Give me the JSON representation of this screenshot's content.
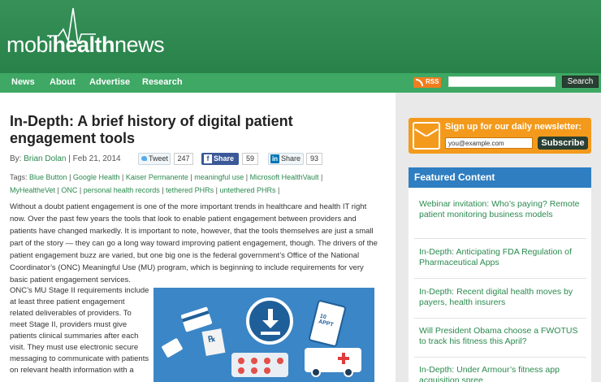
{
  "site": {
    "logo_part1": "mobi",
    "logo_part2": "health",
    "logo_part3": "news"
  },
  "nav": {
    "items": [
      "News",
      "About",
      "Advertise",
      "Research"
    ],
    "rss_label": "RSS",
    "search_placeholder": "",
    "search_button": "Search"
  },
  "article": {
    "title": "In-Depth: A brief history of digital patient engagement tools",
    "by_label": "By:",
    "author": "Brian Dolan",
    "date": "| Feb 21, 2014",
    "tweet_label": "Tweet",
    "tweet_count": "247",
    "fb_label": "Share",
    "fb_count": "59",
    "li_label": "Share",
    "li_count": "93",
    "tags_label": "Tags:",
    "tags": [
      "Blue Button",
      "Google Health",
      "Kaiser Permanente",
      "meaningful use",
      "Microsoft HealthVault",
      "MyHealtheVet",
      "ONC",
      "personal health records",
      "tethered PHRs",
      "untethered PHRs"
    ],
    "paragraph1": "Without a doubt patient engagement is one of the more important trends in healthcare and health IT right now. Over the past few years the tools that look to enable patient engagement between providers and patients have changed markedly. It is important to note, however, that the tools themselves are just a small part of the story — they can go a long way toward improving patient engagement, though. The drivers of the patient engagement buzz are varied, but one big one is the federal government’s Office of the National Coordinator’s (ONC) Meaningful Use (MU) program, which is beginning to include requirements for very basic patient engagement services.",
    "paragraph2": "ONC’s MU Stage II requirements include at least three patient engagement related deliverables of providers. To meet Stage II, providers must give patients clinical summaries after each visit. They must use electronic secure messaging to communicate with patients on relevant health information with a",
    "illustration_phone_text": "10 APPT"
  },
  "sidebar": {
    "signup_text": "Sign up for our daily newsletter:",
    "email_value": "you@example.com",
    "subscribe_label": "Subscribe",
    "featured_heading": "Featured Content",
    "featured_items": [
      "Webinar invitation: Who’s paying? Remote patient monitoring business models",
      "In-Depth: Anticipating FDA Regulation of Pharmaceutical Apps",
      "In-Depth: Recent digital health moves by payers, health insurers",
      "Will President Obama choose a FWOTUS to track his fitness this April?",
      "In-Depth: Under Armour’s fitness app acquisition spree"
    ]
  },
  "colors": {
    "header_green": "#2a8a4e",
    "nav_green": "#3ea864",
    "link_green": "#2a8a4e",
    "signup_orange": "#f39a1c",
    "featured_blue": "#2f7ec1"
  }
}
